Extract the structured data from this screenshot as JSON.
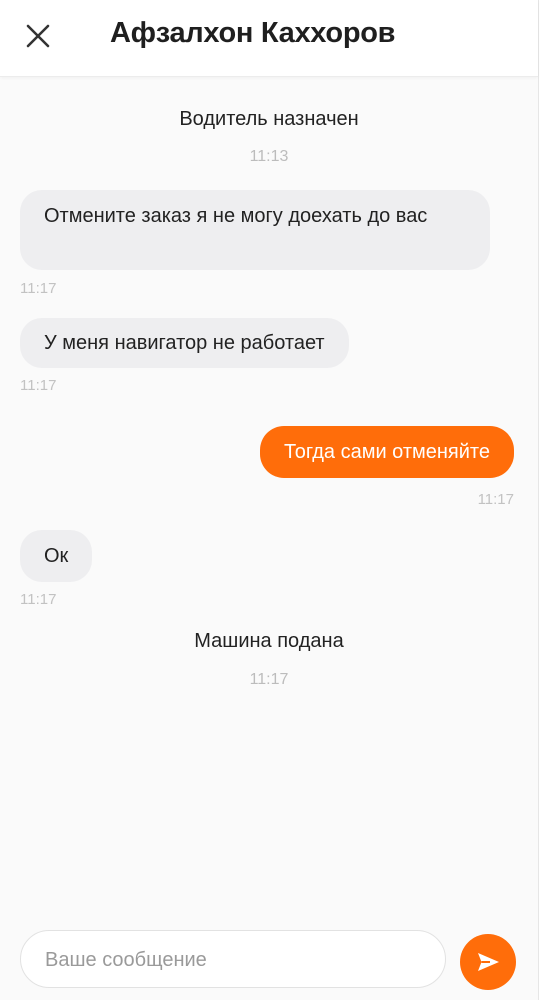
{
  "header": {
    "title": "Афзалхон Каххоров",
    "close_icon": "close-icon"
  },
  "messages": [
    {
      "type": "system",
      "text": "Водитель назначен",
      "time": "11:13"
    },
    {
      "type": "incoming",
      "text": "Отмените заказ я не могу доехать до вас",
      "time": "11:17"
    },
    {
      "type": "incoming",
      "text": "У меня навигатор не работает",
      "time": "11:17"
    },
    {
      "type": "outgoing",
      "text": "Тогда сами отменяйте",
      "time": "11:17"
    },
    {
      "type": "incoming",
      "text": "Ок",
      "time": "11:17"
    },
    {
      "type": "system",
      "text": "Машина подана",
      "time": "11:17"
    }
  ],
  "composer": {
    "value": "",
    "placeholder": "Ваше сообщение",
    "send_icon": "send-icon"
  },
  "colors": {
    "accent": "#ff6d0a",
    "incoming_bubble": "#eeeef0",
    "background": "#fafafa",
    "time_text": "#c2c2c2"
  }
}
